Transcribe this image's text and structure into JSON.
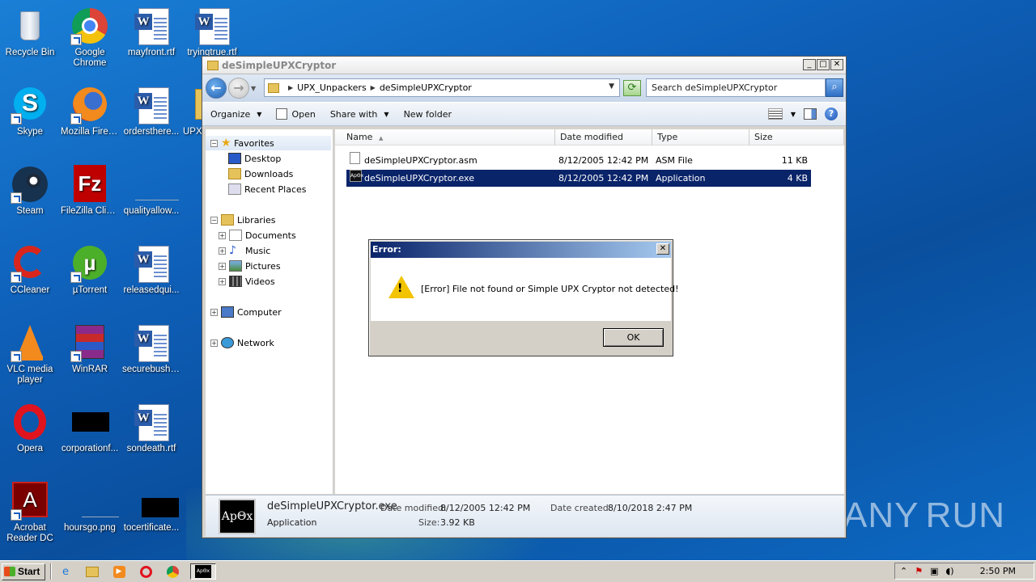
{
  "desktop": {
    "icons": [
      {
        "label": "Recycle Bin"
      },
      {
        "label": "Google Chrome"
      },
      {
        "label": "mayfront.rtf"
      },
      {
        "label": "tryingtrue.rtf"
      },
      {
        "label": "Skype"
      },
      {
        "label": "Mozilla Firefox"
      },
      {
        "label": "ordersthere..."
      },
      {
        "label": "UPX_"
      },
      {
        "label": "Steam"
      },
      {
        "label": "FileZilla Client"
      },
      {
        "label": "qualityallow..."
      },
      {
        "label": "CCleaner"
      },
      {
        "label": "µTorrent"
      },
      {
        "label": "releasedqui..."
      },
      {
        "label": "VLC media player"
      },
      {
        "label": "WinRAR"
      },
      {
        "label": "securebush.rtf"
      },
      {
        "label": "Opera"
      },
      {
        "label": "corporationf..."
      },
      {
        "label": "sondeath.rtf"
      },
      {
        "label": "Acrobat Reader DC"
      },
      {
        "label": "hoursgo.png"
      },
      {
        "label": "tocertificate..."
      }
    ],
    "watermark": {
      "left": "ANY",
      "right": "RUN"
    }
  },
  "explorer": {
    "title": "deSimpleUPXCryptor",
    "breadcrumb": [
      "UPX_Unpackers",
      "deSimpleUPXCryptor"
    ],
    "search_placeholder": "Search deSimpleUPXCryptor",
    "toolbar": {
      "organize": "Organize",
      "open": "Open",
      "share_with": "Share with",
      "new_folder": "New folder"
    },
    "nav": {
      "favorites": "Favorites",
      "desktop": "Desktop",
      "downloads": "Downloads",
      "recent_places": "Recent Places",
      "libraries": "Libraries",
      "documents": "Documents",
      "music": "Music",
      "pictures": "Pictures",
      "videos": "Videos",
      "computer": "Computer",
      "network": "Network"
    },
    "columns": {
      "name": "Name",
      "date_modified": "Date modified",
      "type": "Type",
      "size": "Size"
    },
    "files": [
      {
        "name": "deSimpleUPXCryptor.asm",
        "date": "8/12/2005 12:42 PM",
        "type": "ASM File",
        "size": "11 KB"
      },
      {
        "name": "deSimpleUPXCryptor.exe",
        "date": "8/12/2005 12:42 PM",
        "type": "Application",
        "size": "4 KB"
      }
    ],
    "details": {
      "filename": "deSimpleUPXCryptor.exe",
      "kind": "Application",
      "date_modified_label": "Date modified:",
      "date_modified": "8/12/2005 12:42 PM",
      "date_created_label": "Date created:",
      "date_created": "8/10/2018 2:47 PM",
      "size_label": "Size:",
      "size": "3.92 KB",
      "thumb_text": "ApΘx"
    }
  },
  "dialog": {
    "title": "Error:",
    "message": "[Error] File not found or Simple UPX Cryptor not detected!",
    "ok_label": "OK"
  },
  "taskbar": {
    "start_label": "Start",
    "clock": "2:50 PM"
  }
}
